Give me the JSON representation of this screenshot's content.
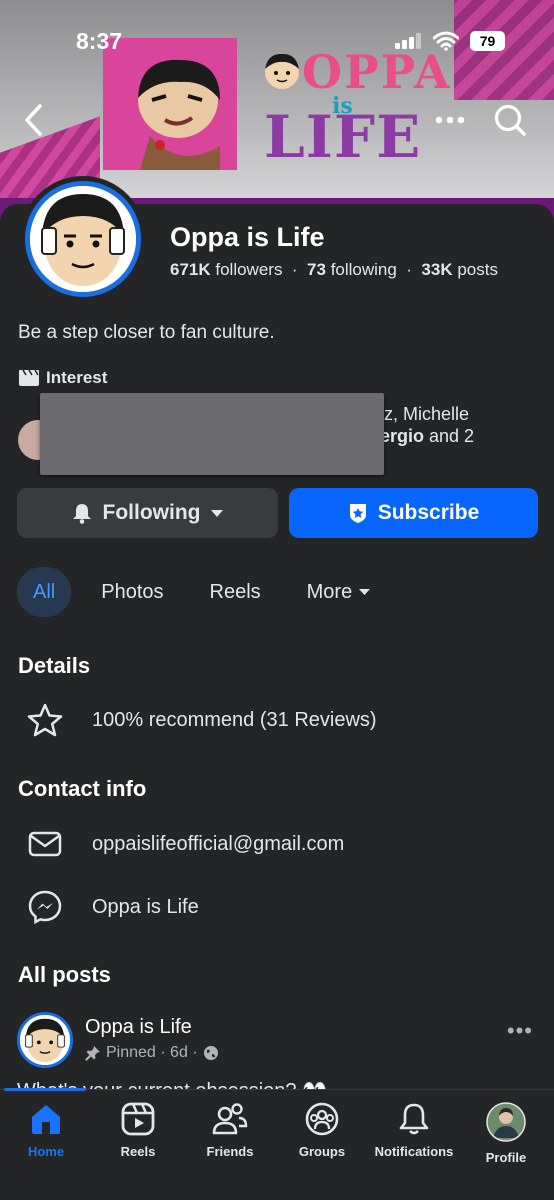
{
  "status_bar": {
    "time": "8:37",
    "battery": "79"
  },
  "cover": {
    "brand_line1": "OPPA",
    "brand_line2": "is",
    "brand_line3": "LIFE"
  },
  "page": {
    "name": "Oppa is Life",
    "followers_count": "671K",
    "followers_label": "followers",
    "following_count": "73",
    "following_label": "following",
    "posts_count": "33K",
    "posts_label": "posts",
    "bio": "Be a step closer to fan culture.",
    "interest": "Interest",
    "friends_line1": "ez, Michelle",
    "friends_line2_bold": "ergio",
    "friends_line2_rest": " and 2"
  },
  "actions": {
    "following": "Following",
    "subscribe": "Subscribe"
  },
  "tabs": [
    {
      "label": "All",
      "active": true
    },
    {
      "label": "Photos"
    },
    {
      "label": "Reels"
    },
    {
      "label": "More"
    }
  ],
  "details": {
    "heading": "Details",
    "recommend": "100% recommend (31 Reviews)"
  },
  "contact": {
    "heading": "Contact info",
    "email": "oppaislifeofficial@gmail.com",
    "messenger": "Oppa is Life"
  },
  "posts": {
    "heading": "All posts",
    "author": "Oppa is Life",
    "meta": "Pinned · 6d ·",
    "text_preview": "What's your current obsession? 👀"
  },
  "tabbar": [
    {
      "label": "Home",
      "icon": "home-icon",
      "active": true
    },
    {
      "label": "Reels",
      "icon": "reels-icon"
    },
    {
      "label": "Friends",
      "icon": "friends-icon"
    },
    {
      "label": "Groups",
      "icon": "groups-icon"
    },
    {
      "label": "Notifications",
      "icon": "bell-icon"
    },
    {
      "label": "Profile",
      "icon": "profile-avatar"
    }
  ],
  "colors": {
    "accent": "#0866ff",
    "background": "#242526",
    "tab_active_bg": "#263951"
  }
}
